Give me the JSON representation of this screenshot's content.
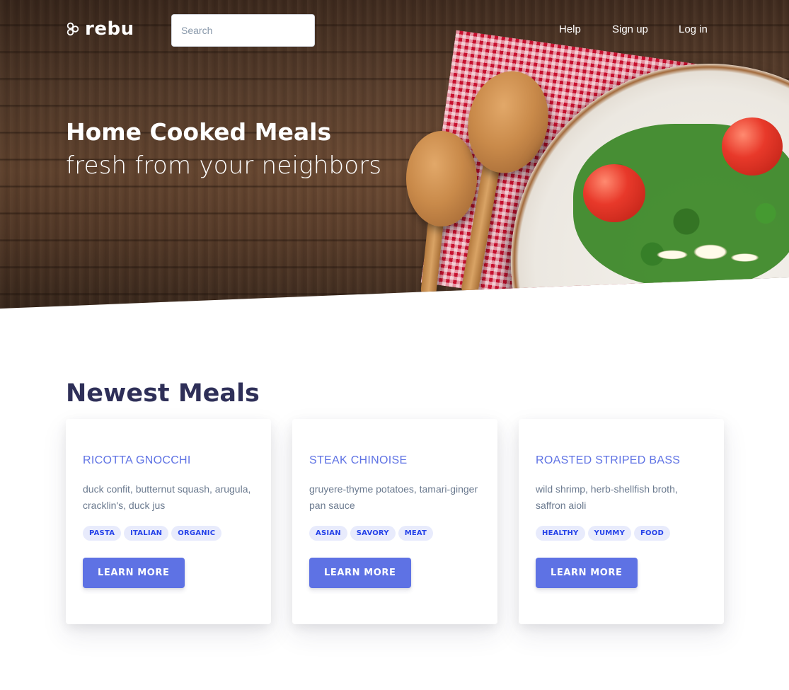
{
  "brand": {
    "name": "rebu",
    "icon": "logo-icon"
  },
  "search": {
    "placeholder": "Search"
  },
  "nav": {
    "help": "Help",
    "signup": "Sign up",
    "login": "Log in"
  },
  "hero": {
    "title": "Home Cooked Meals",
    "subtitle": "fresh from your neighbors"
  },
  "section": {
    "title": "Newest Meals"
  },
  "meals": [
    {
      "title": "Ricotta Gnocchi",
      "description": "duck confit, butternut squash, arugula, cracklin's, duck jus",
      "tags": [
        "Pasta",
        "Italian",
        "Organic"
      ],
      "button": "Learn More"
    },
    {
      "title": "Steak Chinoise",
      "description": "gruyere-thyme potatoes, tamari-ginger pan sauce",
      "tags": [
        "Asian",
        "Savory",
        "Meat"
      ],
      "button": "Learn More"
    },
    {
      "title": "Roasted Striped Bass",
      "description": "wild shrimp, herb-shellfish broth, saffron aioli",
      "tags": [
        "Healthy",
        "Yummy",
        "Food"
      ],
      "button": "Learn More"
    }
  ],
  "colors": {
    "accent": "#5e72e4",
    "heading": "#2e2f58",
    "tag_bg": "#e8ebfc",
    "tag_text": "#2643e9"
  }
}
